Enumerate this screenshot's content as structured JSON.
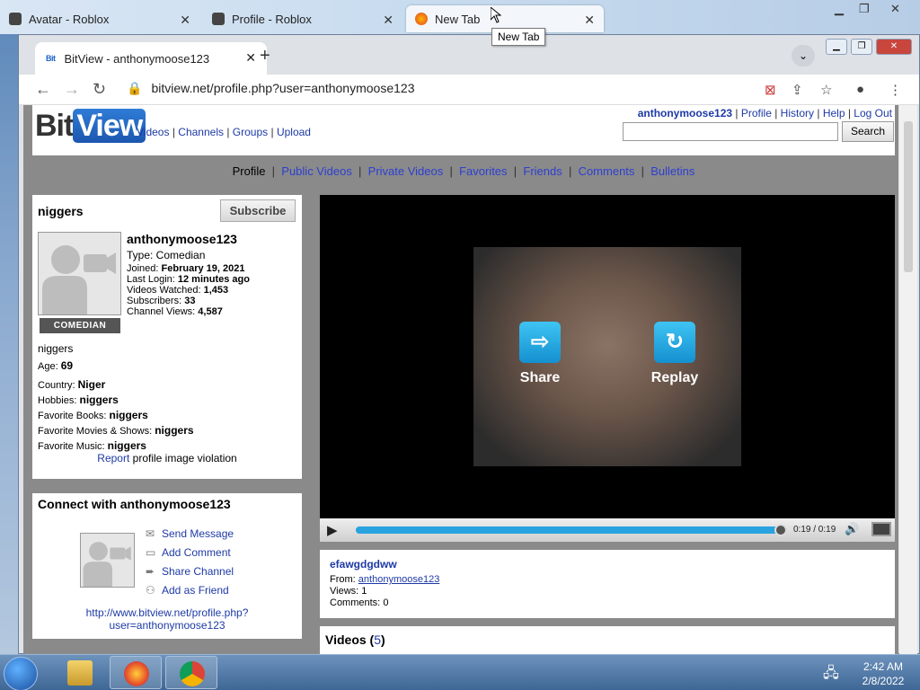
{
  "outer_tabs": [
    {
      "label": "Avatar - Roblox"
    },
    {
      "label": "Profile - Roblox"
    },
    {
      "label": "New Tab"
    }
  ],
  "tooltip": "New Tab",
  "browser": {
    "tab_title": "BitView - anthonymoose123",
    "tab_favicon": "Bit",
    "url": "bitview.net/profile.php?user=anthonymoose123"
  },
  "site": {
    "logo_bit": "Bit",
    "logo_view": "View",
    "nav": [
      "Videos",
      "Channels",
      "Groups",
      "Upload"
    ],
    "user_nav": {
      "username": "anthonymoose123",
      "links": [
        "Profile",
        "History",
        "Help",
        "Log Out"
      ]
    },
    "search_button": "Search",
    "search_value": ""
  },
  "subnav": {
    "current": "Profile",
    "links": [
      "Public Videos",
      "Private Videos",
      "Favorites",
      "Friends",
      "Comments",
      "Bulletins"
    ]
  },
  "profile": {
    "title": "niggers",
    "subscribe_label": "Subscribe",
    "badge": "COMEDIAN",
    "username": "anthonymoose123",
    "type": "Type: Comedian",
    "joined_label": "Joined:",
    "joined": "February 19, 2021",
    "login_label": "Last Login:",
    "login": "12 minutes ago",
    "watched_label": "Videos Watched:",
    "watched": "1,453",
    "subs_label": "Subscribers:",
    "subs": "33",
    "views_label": "Channel Views:",
    "views": "4,587",
    "about": "niggers",
    "age_label": "Age:",
    "age": "69",
    "country_label": "Country:",
    "country": "Niger",
    "hobbies_label": "Hobbies:",
    "hobbies": "niggers",
    "books_label": "Favorite Books:",
    "books": "niggers",
    "movies_label": "Favorite Movies & Shows:",
    "movies": "niggers",
    "music_label": "Favorite Music:",
    "music": "niggers",
    "report_link": "Report",
    "report_text": " profile image violation"
  },
  "connect": {
    "title": "Connect with anthonymoose123",
    "actions": [
      "Send Message",
      "Add Comment",
      "Share Channel",
      "Add as Friend"
    ],
    "url_line1": "http://www.bitview.net/profile.php?",
    "url_line2": "user=anthonymoose123"
  },
  "player": {
    "share_label": "Share",
    "replay_label": "Replay",
    "time": "0:19 / 0:19",
    "progress": 1.0
  },
  "video": {
    "title": "efawgdgdww",
    "from_label": "From:",
    "from": "anthonymoose123",
    "views_label": "Views:",
    "views": "1",
    "comments_label": "Comments:",
    "comments": "0"
  },
  "videos_section": {
    "label": "Videos",
    "count": "5"
  },
  "taskbar": {
    "time": "2:42 AM",
    "date": "2/8/2022"
  }
}
